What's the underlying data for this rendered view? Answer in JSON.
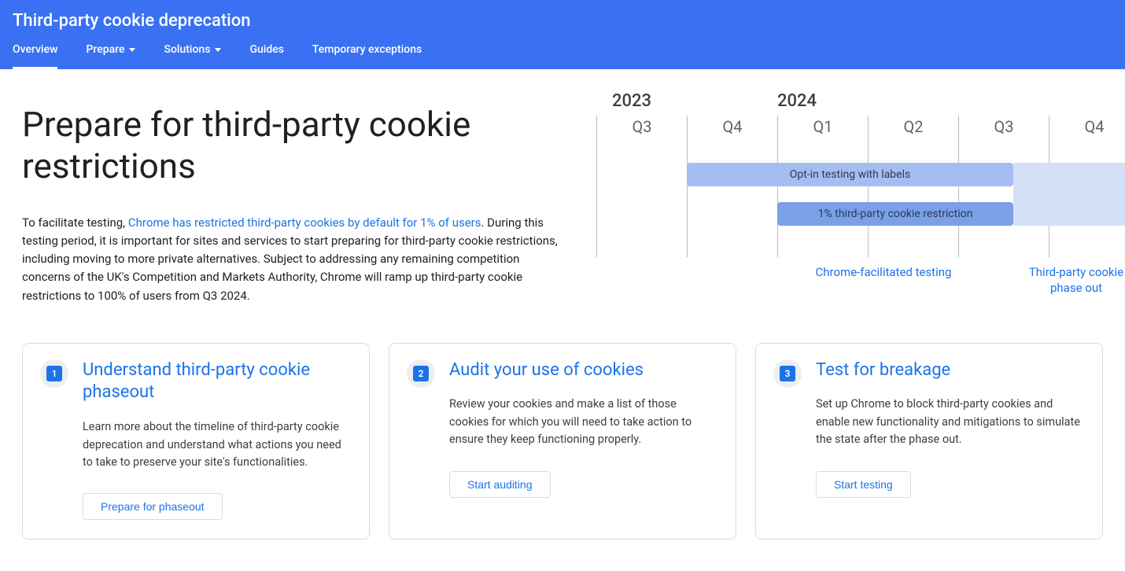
{
  "header": {
    "site_title": "Third-party cookie deprecation",
    "nav": [
      {
        "label": "Overview",
        "has_dropdown": false,
        "active": true
      },
      {
        "label": "Prepare",
        "has_dropdown": true,
        "active": false
      },
      {
        "label": "Solutions",
        "has_dropdown": true,
        "active": false
      },
      {
        "label": "Guides",
        "has_dropdown": false,
        "active": false
      },
      {
        "label": "Temporary exceptions",
        "has_dropdown": false,
        "active": false
      }
    ]
  },
  "hero": {
    "title": "Prepare for third-party cookie restrictions",
    "lead_before": "To facilitate testing, ",
    "lead_link": "Chrome has restricted third-party cookies by default for 1% of users",
    "lead_after": ". During this testing period, it is important for sites and services to start preparing for third-party cookie restrictions, including moving to more private alternatives. Subject to addressing any remaining competition concerns of the UK's Competition and Markets Authority, Chrome will ramp up third-party cookie restrictions to 100% of users from Q3 2024."
  },
  "timeline": {
    "years": {
      "y1": "2023",
      "y2": "2024"
    },
    "quarters": [
      "Q3",
      "Q4",
      "Q1",
      "Q2",
      "Q3",
      "Q4"
    ],
    "bars": {
      "opt_in": "Opt-in testing with labels",
      "one_pct": "1% third-party cookie restriction"
    },
    "labels": {
      "testing": "Chrome-facilitated testing",
      "phaseout": "Third-party cookie phase out"
    }
  },
  "cards": [
    {
      "num": "1",
      "title": "Understand third-party cookie phaseout",
      "body": "Learn more about the timeline of third-party cookie deprecation and understand what actions you need to take to preserve your site's functionalities.",
      "button": "Prepare for phaseout"
    },
    {
      "num": "2",
      "title": "Audit your use of cookies",
      "body": "Review your cookies and make a list of those cookies for which you will need to take action to ensure they keep functioning properly.",
      "button": "Start auditing"
    },
    {
      "num": "3",
      "title": "Test for breakage",
      "body": "Set up Chrome to block third-party cookies and enable new functionality and mitigations to simulate the state after the phase out.",
      "button": "Start testing"
    }
  ]
}
